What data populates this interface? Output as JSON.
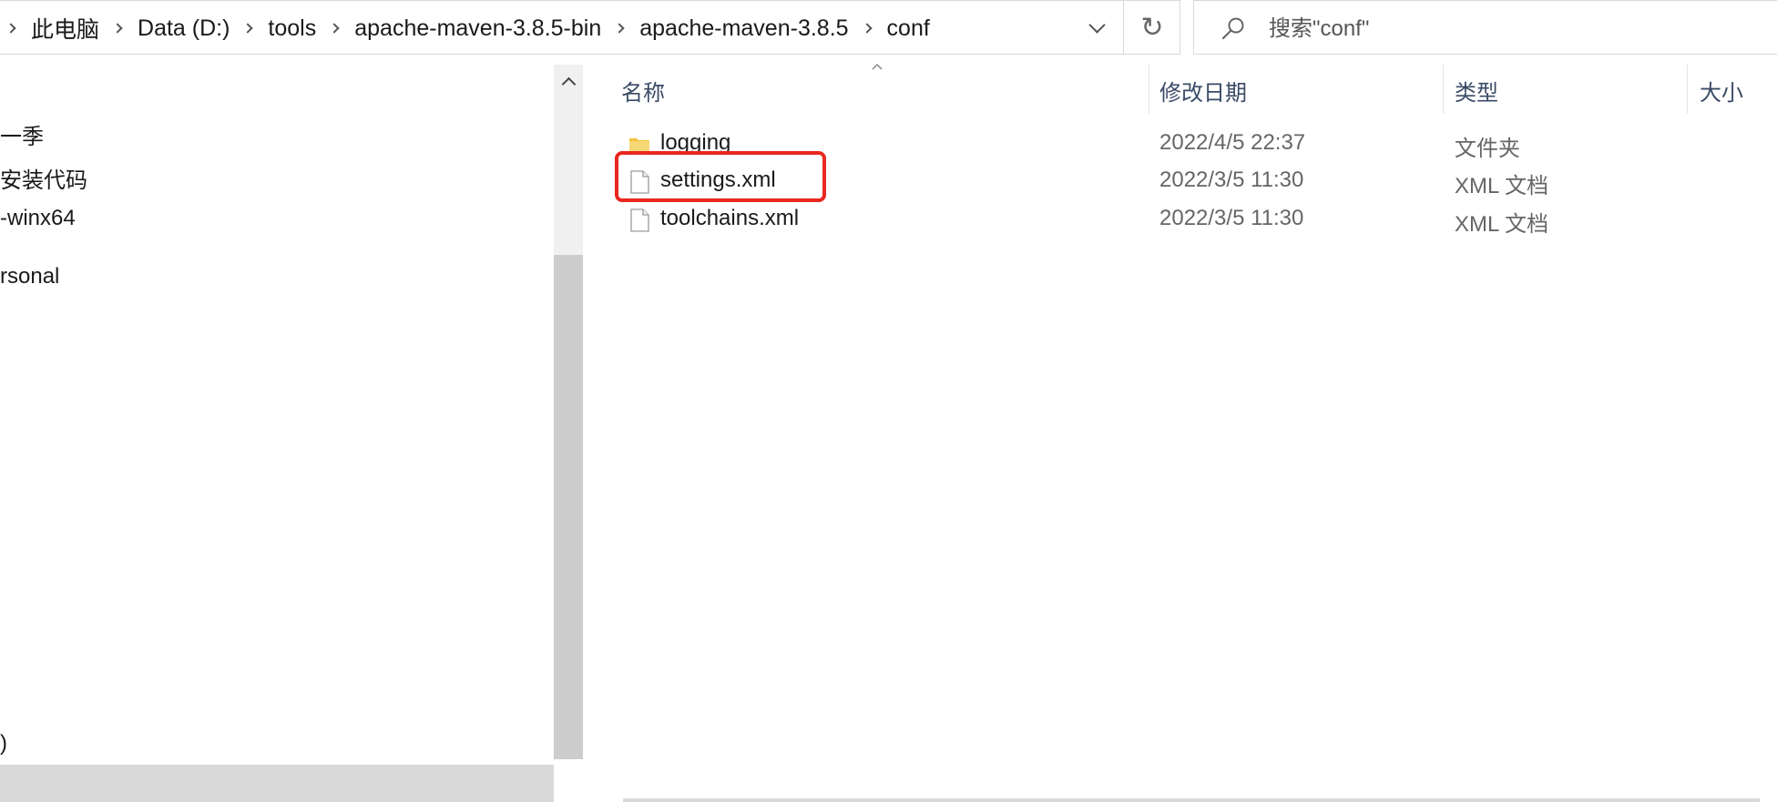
{
  "address_bar": {
    "breadcrumbs": [
      "此电脑",
      "Data (D:)",
      "tools",
      "apache-maven-3.8.5-bin",
      "apache-maven-3.8.5",
      "conf"
    ],
    "dropdown_icon": "chevron-down-icon",
    "refresh_icon": "refresh-icon",
    "refresh_glyph": "↻"
  },
  "search": {
    "placeholder": "搜索\"conf\"",
    "icon": "search-icon"
  },
  "nav": {
    "items": [
      "一季",
      "安装代码",
      "-winx64",
      "rsonal",
      ")"
    ],
    "scroll_up_icon": "chevron-up-icon"
  },
  "columns": {
    "name": "名称",
    "date": "修改日期",
    "type": "类型",
    "size": "大小",
    "sort_indicator": "sort-ascending-icon"
  },
  "files": [
    {
      "name": "logging",
      "date": "2022/4/5 22:37",
      "type": "文件夹",
      "icon": "folder-icon"
    },
    {
      "name": "settings.xml",
      "date": "2022/3/5 11:30",
      "type": "XML 文档",
      "icon": "document-icon"
    },
    {
      "name": "toolchains.xml",
      "date": "2022/3/5 11:30",
      "type": "XML 文档",
      "icon": "document-icon"
    }
  ],
  "colors": {
    "highlight": "#e8271f",
    "folder": "#f3c23e",
    "header_text": "#3a4a66"
  }
}
